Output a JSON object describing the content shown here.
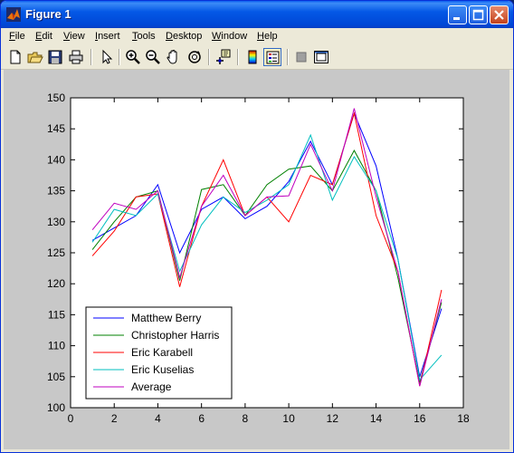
{
  "window": {
    "title": "Figure 1",
    "title_bar_color": "#0054e3"
  },
  "menu": {
    "items": [
      {
        "label": "File",
        "accel": "F",
        "rest": "ile"
      },
      {
        "label": "Edit",
        "accel": "E",
        "rest": "dit"
      },
      {
        "label": "View",
        "accel": "V",
        "rest": "iew"
      },
      {
        "label": "Insert",
        "accel": "I",
        "rest": "nsert"
      },
      {
        "label": "Tools",
        "accel": "T",
        "rest": "ools"
      },
      {
        "label": "Desktop",
        "accel": "D",
        "rest": "esktop"
      },
      {
        "label": "Window",
        "accel": "W",
        "rest": "indow"
      },
      {
        "label": "Help",
        "accel": "H",
        "rest": "elp"
      }
    ]
  },
  "toolbar": {
    "icons": [
      "new-figure-icon",
      "open-file-icon",
      "save-icon",
      "print-icon",
      "edit-plot-arrow-icon",
      "zoom-in-icon",
      "zoom-out-icon",
      "pan-hand-icon",
      "rotate-3d-icon",
      "data-cursor-icon",
      "colorbar-icon",
      "legend-icon",
      "hide-plot-tools-icon",
      "show-plot-tools-icon"
    ]
  },
  "chart_data": {
    "type": "line",
    "x": [
      1,
      2,
      3,
      4,
      5,
      6,
      7,
      8,
      9,
      10,
      11,
      12,
      13,
      14,
      15,
      16,
      17
    ],
    "xlim": [
      0,
      18
    ],
    "ylim": [
      100,
      150
    ],
    "xticks": [
      0,
      2,
      4,
      6,
      8,
      10,
      12,
      14,
      16,
      18
    ],
    "yticks": [
      100,
      105,
      110,
      115,
      120,
      125,
      130,
      135,
      140,
      145,
      150
    ],
    "grid": false,
    "legend_position": "bottom-left",
    "series": [
      {
        "name": "Matthew Berry",
        "color": "#0000ff",
        "values": [
          127,
          129,
          131,
          136,
          125,
          132,
          134,
          130.5,
          132.5,
          136.5,
          143,
          136,
          147.5,
          139,
          124,
          105,
          116
        ]
      },
      {
        "name": "Christopher Harris",
        "color": "#008000",
        "values": [
          125.5,
          130,
          134,
          135,
          120.5,
          135.2,
          136,
          131,
          136,
          138.5,
          139,
          135,
          141.5,
          135,
          121,
          104,
          117
        ]
      },
      {
        "name": "Eric Karabell",
        "color": "#ff0000",
        "values": [
          124.5,
          128.5,
          134,
          134.5,
          119.5,
          132.5,
          140,
          131,
          134,
          130,
          137.5,
          136,
          147.5,
          131,
          122,
          103.5,
          119
        ]
      },
      {
        "name": "Eric Kuselias",
        "color": "#00bfbf",
        "values": [
          126.7,
          132,
          131,
          134.5,
          122,
          129.5,
          134,
          131.5,
          133.5,
          136,
          144,
          133.5,
          140.5,
          135,
          124,
          104.5,
          108.5
        ]
      },
      {
        "name": "Average",
        "color": "#bf00bf",
        "values": [
          128.7,
          133,
          132,
          135,
          121,
          132.5,
          137.5,
          131,
          134,
          134.2,
          142.5,
          135,
          148.3,
          134,
          122,
          103.5,
          117.5
        ]
      }
    ]
  }
}
